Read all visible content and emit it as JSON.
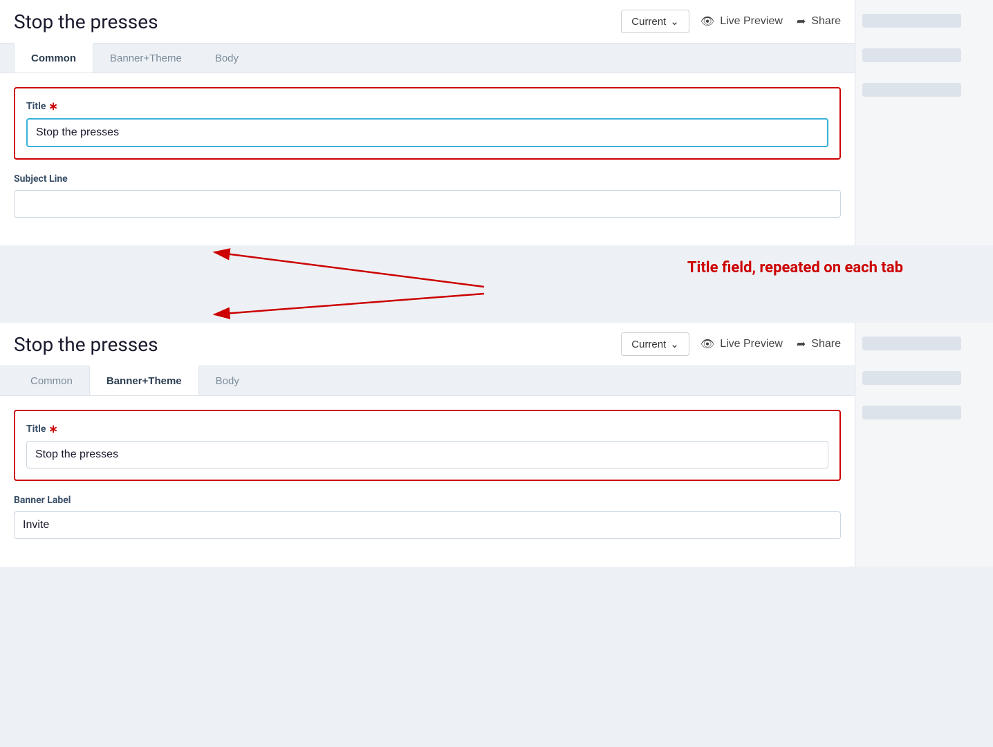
{
  "header": {
    "title": "Stop the presses",
    "current_label": "Current",
    "live_preview_label": "Live Preview",
    "share_label": "Share"
  },
  "top_panel": {
    "tabs": [
      {
        "id": "common",
        "label": "Common",
        "active": true
      },
      {
        "id": "banner_theme",
        "label": "Banner+Theme",
        "active": false
      },
      {
        "id": "body",
        "label": "Body",
        "active": false
      }
    ],
    "title_field": {
      "label": "Title",
      "required": true,
      "value": "Stop the presses"
    },
    "subject_field": {
      "label": "Subject Line",
      "value": "",
      "placeholder": ""
    }
  },
  "bottom_panel": {
    "tabs": [
      {
        "id": "common",
        "label": "Common",
        "active": false
      },
      {
        "id": "banner_theme",
        "label": "Banner+Theme",
        "active": true
      },
      {
        "id": "body",
        "label": "Body",
        "active": false
      }
    ],
    "title_field": {
      "label": "Title",
      "required": true,
      "value": "Stop the presses"
    },
    "banner_label_field": {
      "label": "Banner Label",
      "value": "Invite"
    }
  },
  "annotation": {
    "text": "Title field, repeated on each tab"
  },
  "icons": {
    "eye": "👁",
    "share": "➦",
    "chevron_down": "∨"
  }
}
